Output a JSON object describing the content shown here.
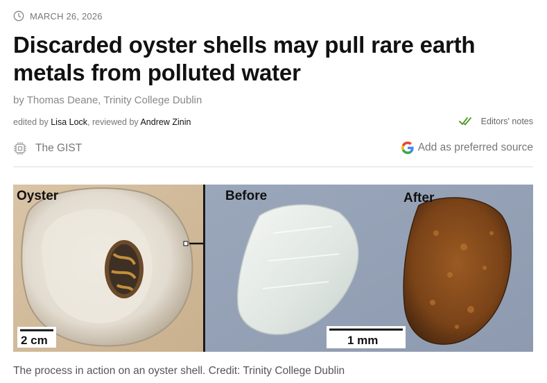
{
  "meta": {
    "date": "MARCH 26, 2026"
  },
  "article": {
    "title": "Discarded oyster shells may pull rare earth metals from polluted water",
    "byline": "by Thomas Deane, Trinity College Dublin",
    "edited_prefix": "edited by ",
    "editor": "Lisa Lock",
    "reviewed_prefix": ", reviewed by ",
    "reviewer": "Andrew Zinin",
    "editors_notes": "Editors' notes",
    "gist": "The GIST",
    "preferred_source": "Add as preferred source"
  },
  "figure": {
    "panel_left_label": "Oyster",
    "panel_before_label": "Before",
    "panel_after_label": "After",
    "scale_left": "2 cm",
    "scale_right": "1 mm",
    "caption": "The process in action on an oyster shell. Credit: Trinity College Dublin"
  },
  "colors": {
    "check": "#5a9a2e",
    "google_blue": "#4285F4",
    "google_red": "#EA4335",
    "google_yellow": "#FBBC05",
    "google_green": "#34A853"
  },
  "icons": {
    "date": "clock-icon",
    "notes": "double-check-icon",
    "gist": "chip-icon",
    "source": "google-g-icon"
  }
}
